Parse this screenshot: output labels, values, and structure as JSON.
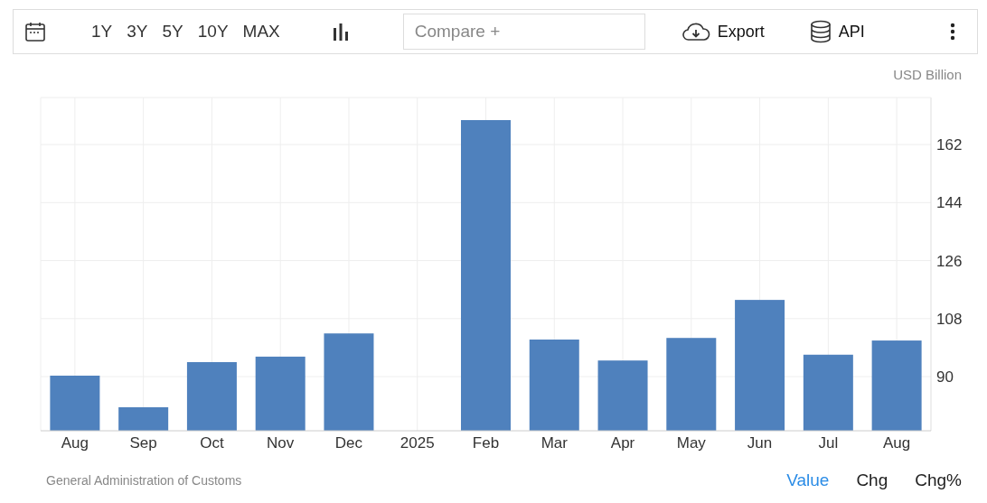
{
  "toolbar": {
    "ranges": [
      "1Y",
      "3Y",
      "5Y",
      "10Y",
      "MAX"
    ],
    "compare": {
      "placeholder": "Compare +"
    },
    "export": "Export",
    "api": "API"
  },
  "chart": {
    "unit": "USD Billion",
    "chart_data": {
      "type": "bar",
      "categories": [
        "Aug",
        "Sep",
        "Oct",
        "Nov",
        "Dec",
        "2025",
        "Feb",
        "Mar",
        "Apr",
        "May",
        "Jun",
        "Jul",
        "Aug"
      ],
      "series": [
        {
          "color": "#4f81bd",
          "values": [
            90.3,
            80.5,
            94.5,
            96.2,
            103.4,
            null,
            169.6,
            101.5,
            95.0,
            102.0,
            113.8,
            96.8,
            101.2
          ]
        }
      ],
      "ylim": [
        73.2,
        176.6
      ],
      "grid": true,
      "yticks": [
        90,
        108,
        126,
        144,
        162
      ]
    }
  },
  "footer": {
    "source": "General Administration of Customs",
    "views": [
      {
        "label": "Value",
        "selected": true
      },
      {
        "label": "Chg",
        "selected": false
      },
      {
        "label": "Chg%",
        "selected": false
      }
    ]
  }
}
